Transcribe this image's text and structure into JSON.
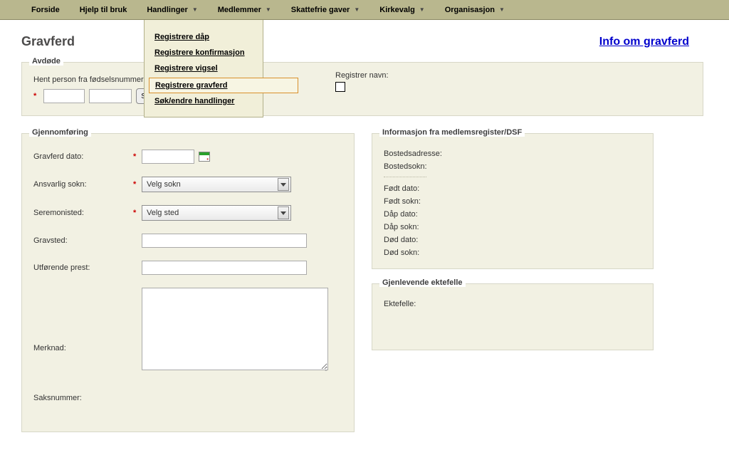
{
  "nav": {
    "items": [
      {
        "label": "Forside",
        "dropdown": false
      },
      {
        "label": "Hjelp til bruk",
        "dropdown": false
      },
      {
        "label": "Handlinger",
        "dropdown": true
      },
      {
        "label": "Medlemmer",
        "dropdown": true
      },
      {
        "label": "Skattefrie gaver",
        "dropdown": true
      },
      {
        "label": "Kirkevalg",
        "dropdown": true
      },
      {
        "label": "Organisasjon",
        "dropdown": true
      }
    ]
  },
  "dropdown": {
    "items": [
      "Registrere dåp",
      "Registrere konfirmasjon",
      "Registrere vigsel",
      "Registrere gravferd",
      "Søk/endre handlinger"
    ],
    "selected_index": 3
  },
  "page": {
    "title": "Gravferd",
    "info_link": "Info om gravferd"
  },
  "avdode": {
    "legend": "Avdøde",
    "hent_label": "Hent person fra fødselsnummer",
    "sok_btn": "Søk",
    "registrer_navn_label": "Registrer navn:",
    "input1": "",
    "input2": ""
  },
  "gjennom": {
    "legend": "Gjennomføring",
    "gravferd_dato_label": "Gravferd dato:",
    "gravferd_dato_value": "",
    "ansvarlig_sokn_label": "Ansvarlig sokn:",
    "ansvarlig_sokn_value": "Velg sokn",
    "seremonisted_label": "Seremonisted:",
    "seremonisted_value": "Velg sted",
    "gravsted_label": "Gravsted:",
    "gravsted_value": "",
    "utforende_prest_label": "Utførende prest:",
    "utforende_prest_value": "",
    "merknad_label": "Merknad:",
    "merknad_value": "",
    "saksnummer_label": "Saksnummer:"
  },
  "info": {
    "legend": "Informasjon fra medlemsregister/DSF",
    "bostedsadresse": "Bostedsadresse:",
    "bostedsokn": "Bostedsokn:",
    "fodt_dato": "Født dato:",
    "fodt_sokn": "Født sokn:",
    "dap_dato": "Dåp dato:",
    "dap_sokn": "Dåp sokn:",
    "dod_dato": "Død dato:",
    "dod_sokn": "Død sokn:"
  },
  "ekte": {
    "legend": "Gjenlevende ektefelle",
    "ektefelle": "Ektefelle:"
  }
}
